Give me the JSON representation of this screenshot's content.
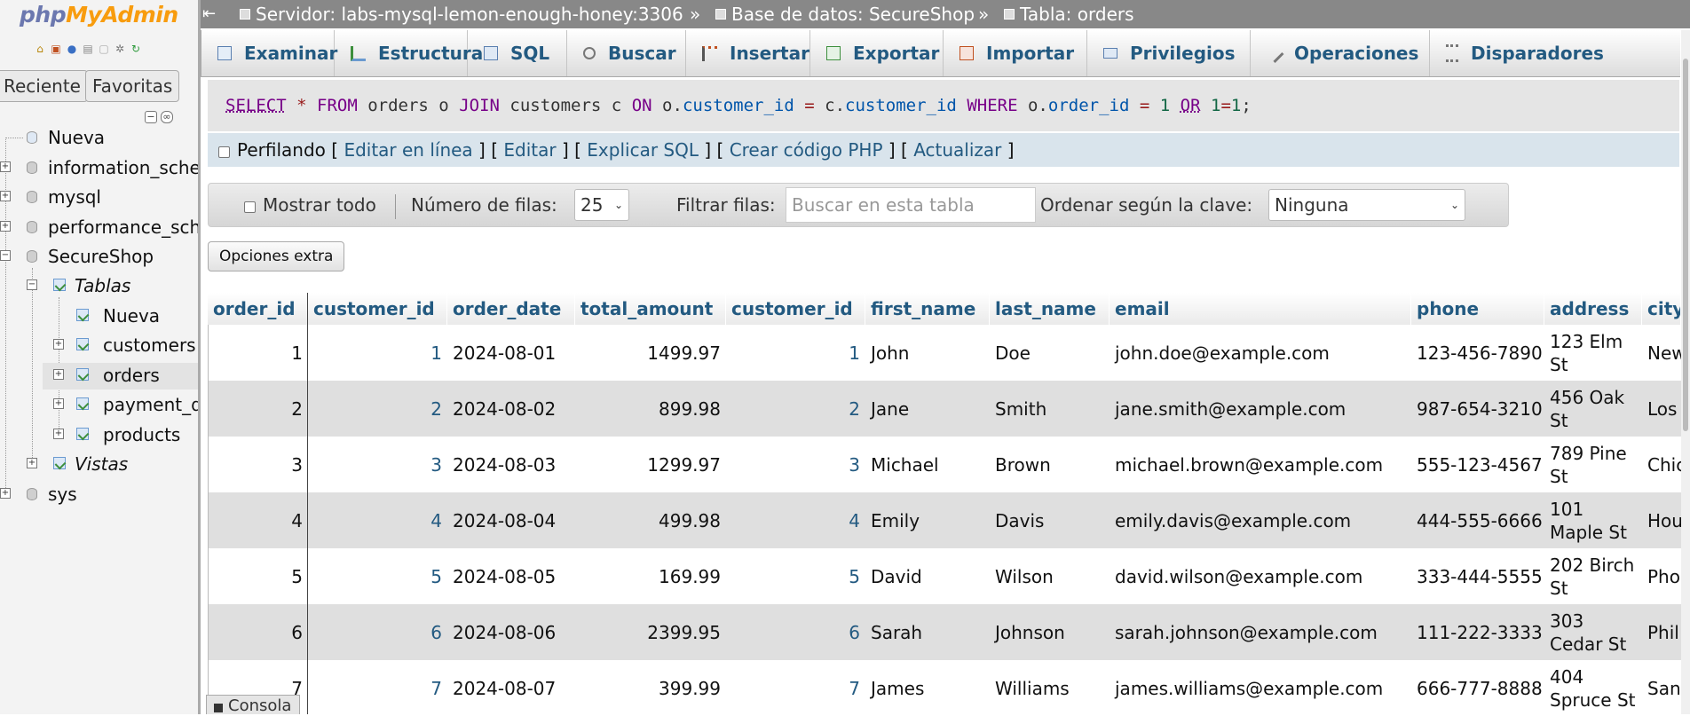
{
  "app": {
    "logo_php": "php",
    "logo_myadmin": "MyAdmin"
  },
  "sidebar": {
    "tabs": [
      "Reciente",
      "Favoritas"
    ],
    "tree": {
      "new": "Nueva",
      "dbs": [
        "information_sche",
        "mysql",
        "performance_sch",
        "SecureShop"
      ],
      "group_tables": "Tablas",
      "table_new": "Nueva",
      "tables": [
        "customers",
        "orders",
        "payment_d",
        "products"
      ],
      "group_views": "Vistas",
      "sys": "sys"
    }
  },
  "breadcrumb": {
    "server": "Servidor: labs-mysql-lemon-enough-honey:3306",
    "database": "Base de datos: SecureShop",
    "table": "Tabla: orders",
    "sep": "»"
  },
  "menu": [
    "Examinar",
    "Estructura",
    "SQL",
    "Buscar",
    "Insertar",
    "Exportar",
    "Importar",
    "Privilegios",
    "Operaciones",
    "Disparadores"
  ],
  "sql": {
    "t1": "SELECT",
    "t2": "*",
    "t3": "FROM",
    "t4": "orders o",
    "t5": "JOIN",
    "t6": "customers c",
    "t7": "ON",
    "t8": "o.",
    "t9": "customer_id",
    "t10": "=",
    "t11": "c.",
    "t12": "customer_id",
    "t13": "WHERE",
    "t14": "o.",
    "t15": "order_id",
    "t16": "=",
    "t17": "1",
    "t18": "OR",
    "t19": "1",
    "t20": "=",
    "t21": "1",
    "t22": ";"
  },
  "profiling": {
    "label": "Perfilando",
    "links": [
      "Editar en línea",
      "Editar",
      "Explicar SQL",
      "Crear código PHP",
      "Actualizar"
    ]
  },
  "navbar": {
    "show_all": "Mostrar todo",
    "rows_label": "Número de filas:",
    "rows_value": "25",
    "filter_label": "Filtrar filas:",
    "filter_placeholder": "Buscar en esta tabla",
    "sort_label": "Ordenar según la clave:",
    "sort_value": "Ninguna"
  },
  "extra_options": "Opciones extra",
  "table": {
    "columns": [
      "order_id",
      "customer_id",
      "order_date",
      "total_amount",
      "customer_id",
      "first_name",
      "last_name",
      "email",
      "phone",
      "address",
      "city"
    ],
    "rows": [
      [
        "1",
        "1",
        "2024-08-01",
        "1499.97",
        "1",
        "John",
        "Doe",
        "john.doe@example.com",
        "123-456-7890",
        "123 Elm St",
        "New"
      ],
      [
        "2",
        "2",
        "2024-08-02",
        "899.98",
        "2",
        "Jane",
        "Smith",
        "jane.smith@example.com",
        "987-654-3210",
        "456 Oak St",
        "Los"
      ],
      [
        "3",
        "3",
        "2024-08-03",
        "1299.97",
        "3",
        "Michael",
        "Brown",
        "michael.brown@example.com",
        "555-123-4567",
        "789 Pine St",
        "Chic"
      ],
      [
        "4",
        "4",
        "2024-08-04",
        "499.98",
        "4",
        "Emily",
        "Davis",
        "emily.davis@example.com",
        "444-555-6666",
        "101 Maple St",
        "Hou"
      ],
      [
        "5",
        "5",
        "2024-08-05",
        "169.99",
        "5",
        "David",
        "Wilson",
        "david.wilson@example.com",
        "333-444-5555",
        "202 Birch St",
        "Pho"
      ],
      [
        "6",
        "6",
        "2024-08-06",
        "2399.95",
        "6",
        "Sarah",
        "Johnson",
        "sarah.johnson@example.com",
        "111-222-3333",
        "303 Cedar St",
        "Phil"
      ],
      [
        "7",
        "7",
        "2024-08-07",
        "399.99",
        "7",
        "James",
        "Williams",
        "james.williams@example.com",
        "666-777-8888",
        "404 Spruce St",
        "San"
      ]
    ]
  },
  "console_label": "Consola"
}
